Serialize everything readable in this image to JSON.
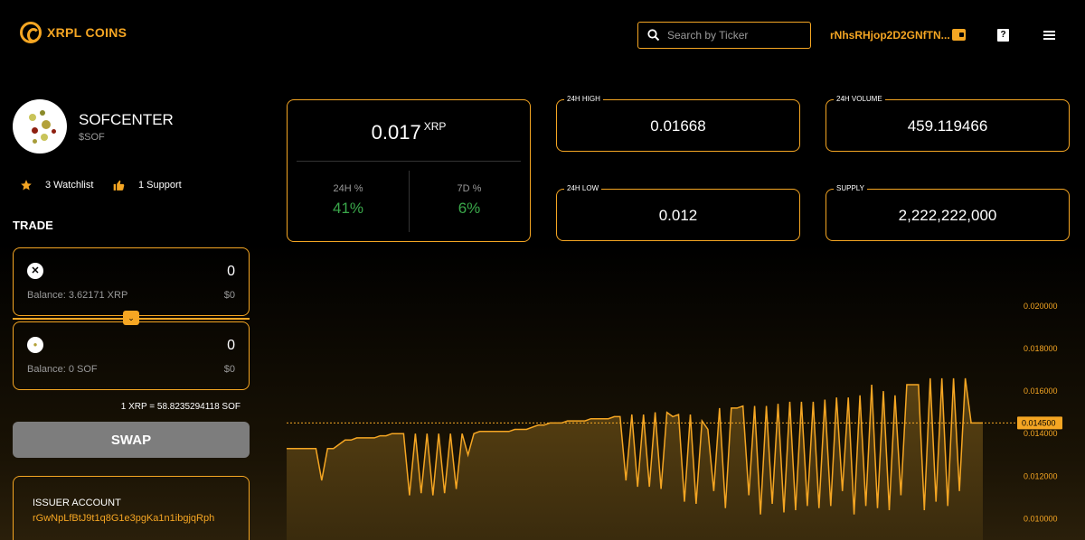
{
  "header": {
    "brand": "XRPL COINS",
    "search_placeholder": "Search by Ticker",
    "wallet_address": "rNhsRHjop2D2GNfTN..."
  },
  "token": {
    "name": "SOFCENTER",
    "symbol": "$SOF",
    "watchlist_label": "3 Watchlist",
    "support_label": "1 Support"
  },
  "trade": {
    "title": "TRADE",
    "from": {
      "icon": "xrp-icon",
      "amount": "0",
      "balance": "Balance: 3.62171 XRP",
      "usd": "$0"
    },
    "to": {
      "icon": "sof-icon",
      "amount": "0",
      "balance": "Balance: 0 SOF",
      "usd": "$0"
    },
    "rate": "1 XRP = 58.8235294118 SOF",
    "swap_label": "SWAP"
  },
  "issuer": {
    "label": "ISSUER ACCOUNT",
    "address": "rGwNpLfBtJ9t1q8G1e3pgKa1n1ibgjqRph"
  },
  "stats": {
    "price_value": "0.017",
    "price_unit": "XRP",
    "change_24h_label": "24H %",
    "change_24h": "41%",
    "change_7d_label": "7D %",
    "change_7d": "6%",
    "high_label": "24H HIGH",
    "high": "0.01668",
    "volume_label": "24H VOLUME",
    "volume": "459.119466",
    "low_label": "24H LOW",
    "low": "0.012",
    "supply_label": "SUPPLY",
    "supply": "2,222,222,000"
  },
  "colors": {
    "accent": "#f5a623",
    "positive": "#3aa84a",
    "muted": "#9a9a9a"
  },
  "chart_data": {
    "type": "area",
    "x": [
      0,
      1,
      2,
      3,
      4,
      5,
      6,
      7,
      8,
      9,
      10,
      11,
      12,
      13,
      14,
      15,
      16,
      17,
      18,
      19,
      20,
      21,
      22,
      23,
      24,
      25,
      26,
      27,
      28,
      29,
      30,
      31,
      32,
      33,
      34,
      35,
      36,
      37,
      38,
      39,
      40,
      41,
      42,
      43,
      44,
      45,
      46,
      47,
      48,
      49,
      50,
      51,
      52,
      53,
      54,
      55,
      56,
      57,
      58,
      59,
      60,
      61,
      62,
      63,
      64,
      65,
      66,
      67,
      68,
      69,
      70,
      71,
      72,
      73,
      74,
      75,
      76,
      77,
      78,
      79,
      80,
      81,
      82,
      83,
      84,
      85,
      86,
      87,
      88,
      89,
      90,
      91,
      92,
      93,
      94,
      95,
      96,
      97,
      98,
      99,
      100,
      101,
      102,
      103,
      104,
      105,
      106,
      107,
      108,
      109,
      110,
      111,
      112,
      113,
      114,
      115,
      116,
      117,
      118,
      119
    ],
    "values": [
      0.0133,
      0.0133,
      0.0133,
      0.0133,
      0.0133,
      0.0133,
      0.0118,
      0.0133,
      0.0133,
      0.0135,
      0.0137,
      0.0137,
      0.0138,
      0.0138,
      0.0138,
      0.0138,
      0.0139,
      0.0139,
      0.014,
      0.014,
      0.014,
      0.0111,
      0.014,
      0.0112,
      0.014,
      0.0111,
      0.014,
      0.0112,
      0.014,
      0.0114,
      0.014,
      0.013,
      0.014,
      0.0141,
      0.0141,
      0.0141,
      0.0141,
      0.0141,
      0.0141,
      0.0142,
      0.0142,
      0.0142,
      0.0143,
      0.0144,
      0.0144,
      0.0145,
      0.0145,
      0.0145,
      0.0146,
      0.0146,
      0.0146,
      0.0146,
      0.0147,
      0.0147,
      0.0147,
      0.0147,
      0.0148,
      0.0148,
      0.0118,
      0.0149,
      0.0115,
      0.0149,
      0.0115,
      0.015,
      0.0114,
      0.015,
      0.0148,
      0.0149,
      0.0108,
      0.0149,
      0.0107,
      0.0146,
      0.0142,
      0.0113,
      0.0152,
      0.0105,
      0.0152,
      0.0152,
      0.0153,
      0.0111,
      0.0153,
      0.0102,
      0.0153,
      0.0107,
      0.0154,
      0.0103,
      0.0155,
      0.0104,
      0.0155,
      0.0106,
      0.0155,
      0.0105,
      0.0156,
      0.0106,
      0.0157,
      0.0113,
      0.0157,
      0.0102,
      0.0158,
      0.0106,
      0.0163,
      0.0105,
      0.016,
      0.0104,
      0.0158,
      0.0111,
      0.0163,
      0.0163,
      0.0163,
      0.0104,
      0.0166,
      0.0108,
      0.0166,
      0.0106,
      0.0166,
      0.0113,
      0.0166,
      0.0145,
      0.0145,
      0.0145
    ],
    "current_value": "0.014500",
    "yticks": [
      "0.020000",
      "0.018000",
      "0.016000",
      "0.014000",
      "0.012000",
      "0.010000"
    ],
    "ylim": [
      0.009,
      0.0208
    ]
  }
}
